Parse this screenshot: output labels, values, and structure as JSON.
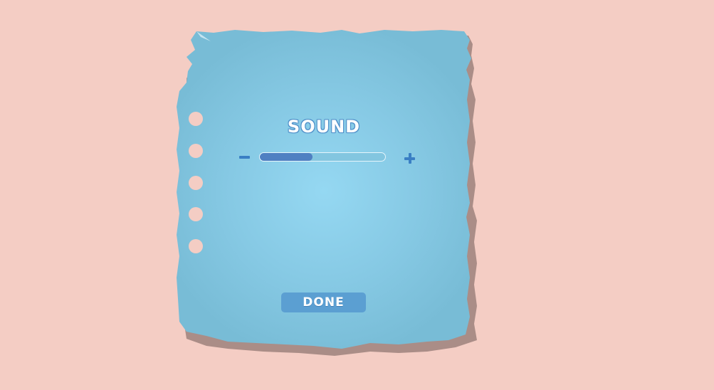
{
  "dialog": {
    "title": "SOUND",
    "done_label": "DONE",
    "sound_level": 0.42
  },
  "icons": {
    "decrease": "minus-icon",
    "increase": "plus-icon"
  },
  "colors": {
    "background": "#f4cdc4",
    "paper": "#7dc0da",
    "paper_center": "#95d8f2",
    "accent": "#3a7fc4",
    "slider_fill": "#4f80c2",
    "button": "#5b9fd2"
  }
}
